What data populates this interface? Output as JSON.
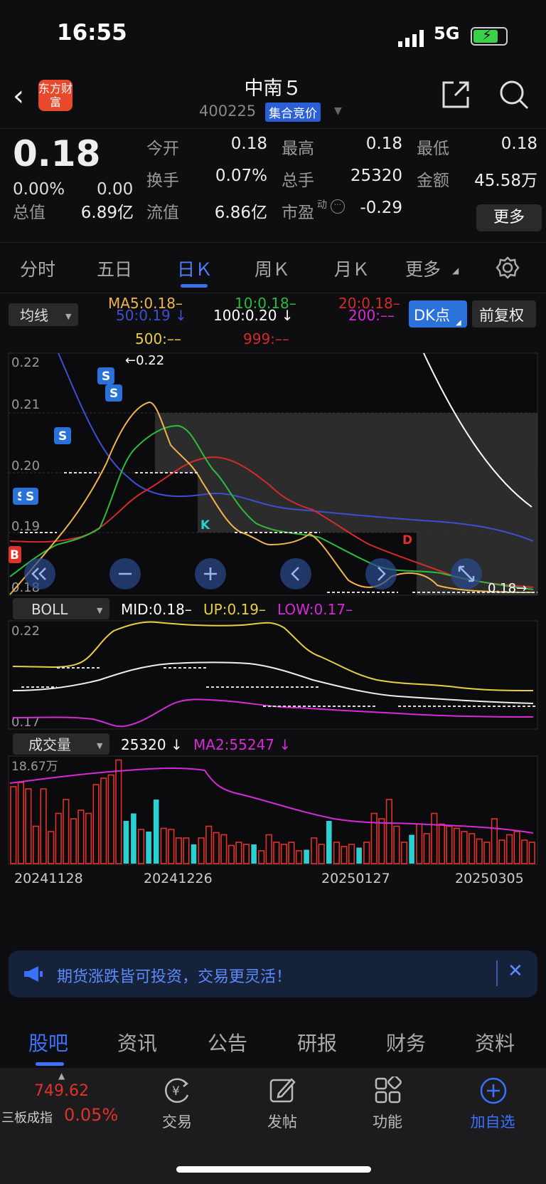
{
  "status_bar": {
    "time": "16:55",
    "network": "5G"
  },
  "header": {
    "back_icon": "chevron-left-icon",
    "logo_text": "东方财富",
    "title": "中南５",
    "code": "400225",
    "auction_badge": "集合竞价",
    "share_icon": "share-icon",
    "search_icon": "search-icon"
  },
  "quote": {
    "price": "0.18",
    "change_pct": "0.00%",
    "change": "0.00",
    "fields": [
      {
        "label": "今开",
        "value": "0.18"
      },
      {
        "label": "最高",
        "value": "0.18"
      },
      {
        "label": "最低",
        "value": "0.18"
      },
      {
        "label": "换手",
        "value": "0.07%"
      },
      {
        "label": "总手",
        "value": "25320"
      },
      {
        "label": "金额",
        "value": "45.58万"
      },
      {
        "label": "总值",
        "value": "6.89亿"
      },
      {
        "label": "流值",
        "value": "6.86亿"
      },
      {
        "label": "市盈",
        "value": "-0.29"
      }
    ],
    "pe_superscript": "动",
    "more_label": "更多"
  },
  "tabs": {
    "items": [
      "分时",
      "五日",
      "日Ｋ",
      "周Ｋ",
      "月Ｋ",
      "更多"
    ],
    "active": "日Ｋ",
    "settings_icon": "gear-icon"
  },
  "ma_panel": {
    "selector": "均线",
    "ma5": "MA5:0.18–",
    "ma10": "10:0.18–",
    "ma20": "20:0.18–",
    "ma50": "50:0.19 ↓",
    "ma100": "100:0.20 ↓",
    "ma200": "200:––",
    "ma500": "500:––",
    "ma999": "999:––",
    "dk_label": "DK点",
    "fq_label": "前复权",
    "y_ticks": [
      "0.22",
      "0.21",
      "0.20",
      "0.19",
      "0.18"
    ],
    "max_marker": "←0.22",
    "last_marker": "0.18→",
    "signals": [
      "S",
      "S",
      "S",
      "S",
      "S",
      "B",
      "K",
      "D"
    ]
  },
  "boll": {
    "selector": "BOLL",
    "mid": "MID:0.18–",
    "up": "UP:0.19–",
    "low": "LOW:0.17–",
    "y_ticks": [
      "0.22",
      "0.17"
    ]
  },
  "volume": {
    "selector": "成交量",
    "value": "25320 ↓",
    "ma2": "MA2:55247 ↓",
    "y_max": "18.67万",
    "dates": [
      "20241128",
      "20241226",
      "20250127",
      "20250305"
    ],
    "bars": [
      [
        0.72,
        "r"
      ],
      [
        0.76,
        "r"
      ],
      [
        0.7,
        "r"
      ],
      [
        0.35,
        "r"
      ],
      [
        0.7,
        "r"
      ],
      [
        0.3,
        "r"
      ],
      [
        0.47,
        "r"
      ],
      [
        0.6,
        "r"
      ],
      [
        0.42,
        "r"
      ],
      [
        0.5,
        "r"
      ],
      [
        0.47,
        "r"
      ],
      [
        0.74,
        "r"
      ],
      [
        0.8,
        "r"
      ],
      [
        0.83,
        "r"
      ],
      [
        0.97,
        "r"
      ],
      [
        0.4,
        "c"
      ],
      [
        0.47,
        "c"
      ],
      [
        0.32,
        "r"
      ],
      [
        0.3,
        "c"
      ],
      [
        0.6,
        "c"
      ],
      [
        0.33,
        "r"
      ],
      [
        0.32,
        "r"
      ],
      [
        0.24,
        "r"
      ],
      [
        0.24,
        "r"
      ],
      [
        0.18,
        "c"
      ],
      [
        0.24,
        "r"
      ],
      [
        0.35,
        "r"
      ],
      [
        0.29,
        "r"
      ],
      [
        0.27,
        "r"
      ],
      [
        0.17,
        "r"
      ],
      [
        0.2,
        "r"
      ],
      [
        0.18,
        "r"
      ],
      [
        0.18,
        "c"
      ],
      [
        0.12,
        "r"
      ],
      [
        0.27,
        "r"
      ],
      [
        0.2,
        "r"
      ],
      [
        0.18,
        "r"
      ],
      [
        0.2,
        "r"
      ],
      [
        0.12,
        "r"
      ],
      [
        0.13,
        "c"
      ],
      [
        0.24,
        "r"
      ],
      [
        0.18,
        "r"
      ],
      [
        0.4,
        "c"
      ],
      [
        0.2,
        "r"
      ],
      [
        0.16,
        "r"
      ],
      [
        0.18,
        "r"
      ],
      [
        0.15,
        "c"
      ],
      [
        0.2,
        "r"
      ],
      [
        0.47,
        "r"
      ],
      [
        0.42,
        "r"
      ],
      [
        0.6,
        "r"
      ],
      [
        0.35,
        "r"
      ],
      [
        0.2,
        "r"
      ],
      [
        0.27,
        "c"
      ],
      [
        0.37,
        "r"
      ],
      [
        0.28,
        "r"
      ],
      [
        0.47,
        "r"
      ],
      [
        0.37,
        "r"
      ],
      [
        0.35,
        "r"
      ],
      [
        0.33,
        "r"
      ],
      [
        0.3,
        "r"
      ],
      [
        0.28,
        "r"
      ],
      [
        0.23,
        "r"
      ],
      [
        0.2,
        "r"
      ],
      [
        0.42,
        "r"
      ],
      [
        0.22,
        "r"
      ],
      [
        0.27,
        "r"
      ],
      [
        0.3,
        "r"
      ],
      [
        0.22,
        "r"
      ],
      [
        0.2,
        "r"
      ]
    ]
  },
  "chart_controls": [
    "double-chevron-left-icon",
    "zoom-out-icon",
    "zoom-in-icon",
    "chevron-left-icon",
    "chevron-right-icon",
    "expand-icon"
  ],
  "banner": {
    "text": "期货涨跌皆可投资，交易更灵活！",
    "icon": "megaphone-icon",
    "close_icon": "close-icon"
  },
  "bottom_tabs": {
    "items": [
      "股吧",
      "资讯",
      "公告",
      "研报",
      "财务",
      "资料"
    ],
    "active": "股吧"
  },
  "dock": {
    "index_value": "749.62",
    "index_name": "三板成指",
    "index_change": "0.05%",
    "items": [
      {
        "label": "交易",
        "icon": "yen-exchange-icon"
      },
      {
        "label": "发帖",
        "icon": "edit-icon"
      },
      {
        "label": "功能",
        "icon": "grid-icon"
      },
      {
        "label": "加自选",
        "icon": "add-circle-icon"
      }
    ]
  },
  "colors": {
    "up": "#e0322a",
    "down": "#2ad1d1",
    "accent": "#3a72ff",
    "ma5": "#f0b44a",
    "ma10": "#2cbb3a",
    "ma20": "#d42a2a",
    "ma50": "#3b4fd0",
    "boll_up": "#e8cf42",
    "boll_low": "#d62ad6"
  }
}
